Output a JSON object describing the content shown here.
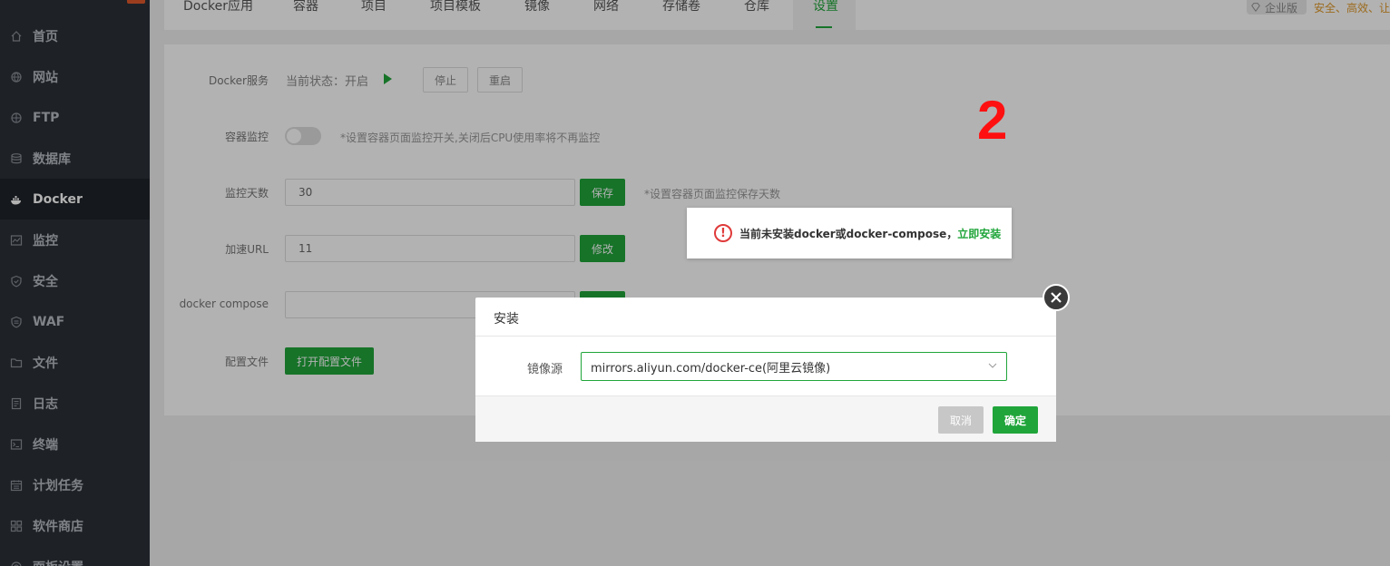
{
  "sidebar": {
    "items": [
      {
        "label": "首页",
        "icon": "home-icon"
      },
      {
        "label": "网站",
        "icon": "globe-icon"
      },
      {
        "label": "FTP",
        "icon": "ftp-icon"
      },
      {
        "label": "数据库",
        "icon": "database-icon"
      },
      {
        "label": "Docker",
        "icon": "docker-icon"
      },
      {
        "label": "监控",
        "icon": "monitor-icon"
      },
      {
        "label": "安全",
        "icon": "shield-icon"
      },
      {
        "label": "WAF",
        "icon": "waf-shield-icon"
      },
      {
        "label": "文件",
        "icon": "folder-icon"
      },
      {
        "label": "日志",
        "icon": "log-icon"
      },
      {
        "label": "终端",
        "icon": "terminal-icon"
      },
      {
        "label": "计划任务",
        "icon": "calendar-icon"
      },
      {
        "label": "软件商店",
        "icon": "grid-icon"
      },
      {
        "label": "面板设置",
        "icon": "settings-icon"
      }
    ]
  },
  "tabs": [
    {
      "label": "Docker应用"
    },
    {
      "label": "容器"
    },
    {
      "label": "项目"
    },
    {
      "label": "项目模板"
    },
    {
      "label": "镜像"
    },
    {
      "label": "网络"
    },
    {
      "label": "存储卷"
    },
    {
      "label": "仓库"
    },
    {
      "label": "设置"
    }
  ],
  "enterprise": {
    "badge": "企业版",
    "slogan": "安全、高效、让"
  },
  "settings": {
    "docker_service_label": "Docker服务",
    "status_text": "当前状态：开启",
    "stop_label": "停止",
    "restart_label": "重启",
    "container_monitor_label": "容器监控",
    "container_monitor_hint": "*设置容器页面监控开关,关闭后CPU使用率将不再监控",
    "monitor_days_label": "监控天数",
    "monitor_days_value": "30",
    "save_label": "保存",
    "monitor_days_hint": "*设置容器页面监控保存天数",
    "accel_url_label": "加速URL",
    "accel_url_value": "11",
    "modify_label": "修改",
    "compose_label": "docker compose",
    "config_file_label": "配置文件",
    "open_config_label": "打开配置文件"
  },
  "annotation": "2",
  "toast": {
    "message": "当前未安装docker或docker-compose，",
    "link": "立即安装"
  },
  "modal": {
    "title": "安装",
    "field_label": "镜像源",
    "selected_value": "mirrors.aliyun.com/docker-ce(阿里云镜像)",
    "cancel_label": "取消",
    "ok_label": "确定"
  },
  "colors": {
    "accent": "#20a53a",
    "warning": "#e03a3a",
    "annotation": "#ff1010"
  }
}
